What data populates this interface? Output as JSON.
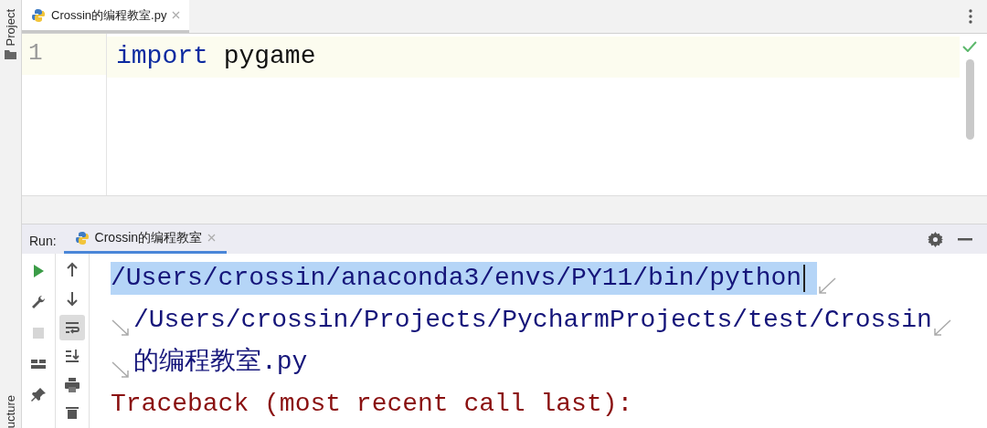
{
  "side_strip": {
    "top_label": "Project",
    "bottom_label": "ucture"
  },
  "editor": {
    "tabs": [
      {
        "label": "Crossin的编程教室.py",
        "selected": true
      }
    ],
    "lines": [
      {
        "number": "1",
        "current": true,
        "tokens": [
          {
            "text": "import",
            "kind": "keyword"
          },
          {
            "text": " pygame",
            "kind": "plain"
          }
        ]
      }
    ],
    "inspection_ok": true
  },
  "run_panel": {
    "label": "Run:",
    "tabs": [
      {
        "label": "Crossin的编程教室",
        "selected": true
      }
    ],
    "tools_left": [
      {
        "kind": "run",
        "disabled": false
      },
      {
        "kind": "wrench",
        "disabled": false
      },
      {
        "kind": "stop",
        "disabled": true
      },
      {
        "kind": "layout",
        "disabled": false
      },
      {
        "kind": "pin",
        "disabled": false
      }
    ],
    "tools_right": [
      {
        "kind": "up",
        "selected": false
      },
      {
        "kind": "down",
        "selected": false
      },
      {
        "kind": "wrap",
        "selected": true
      },
      {
        "kind": "scroll-end",
        "selected": false
      },
      {
        "kind": "print",
        "selected": false
      },
      {
        "kind": "trash",
        "selected": false
      }
    ],
    "console": [
      {
        "text": "/Users/crossin/anaconda3/envs/PY11/bin/python",
        "kind": "stdout",
        "selected": true,
        "wrap_before": false,
        "wrap_after": true
      },
      {
        "text": "/Users/crossin/Projects/PycharmProjects/test/Crossin",
        "kind": "stdout",
        "selected": false,
        "wrap_before": true,
        "wrap_after": true
      },
      {
        "text": "的编程教室.py",
        "kind": "stdout",
        "selected": false,
        "wrap_before": true,
        "wrap_after": false
      },
      {
        "text": "Traceback (most recent call last):",
        "kind": "stderr",
        "selected": false,
        "wrap_before": false,
        "wrap_after": false
      }
    ]
  }
}
